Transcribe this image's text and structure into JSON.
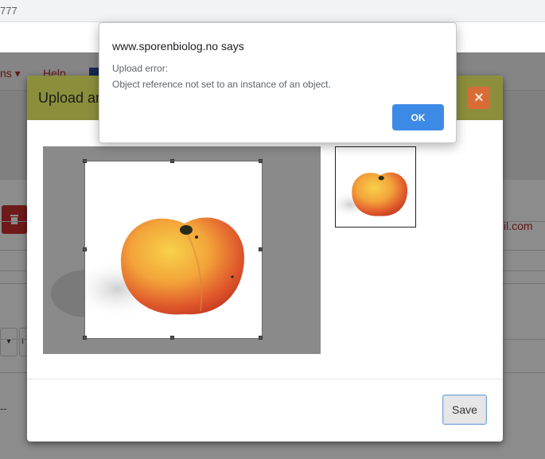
{
  "browser": {
    "url_fragment": "777"
  },
  "background_page": {
    "nav_fragment": "ns ▾",
    "nav_help": "Help",
    "email_fragment": "il.com",
    "delete_icon": "trash-icon",
    "select_arrow": "▾",
    "select2_fragment": "I",
    "dash_text": "--"
  },
  "modal": {
    "title": "Upload an",
    "close_glyph": "×",
    "save_label": "Save",
    "header_color": "#8b8f3b",
    "close_color": "#d96b36"
  },
  "alert": {
    "origin": "www.sporenbiolog.no says",
    "line1": "Upload error:",
    "line2": "Object reference not set to an instance of an object.",
    "ok_label": "OK",
    "ok_color": "#3d8ae6"
  }
}
